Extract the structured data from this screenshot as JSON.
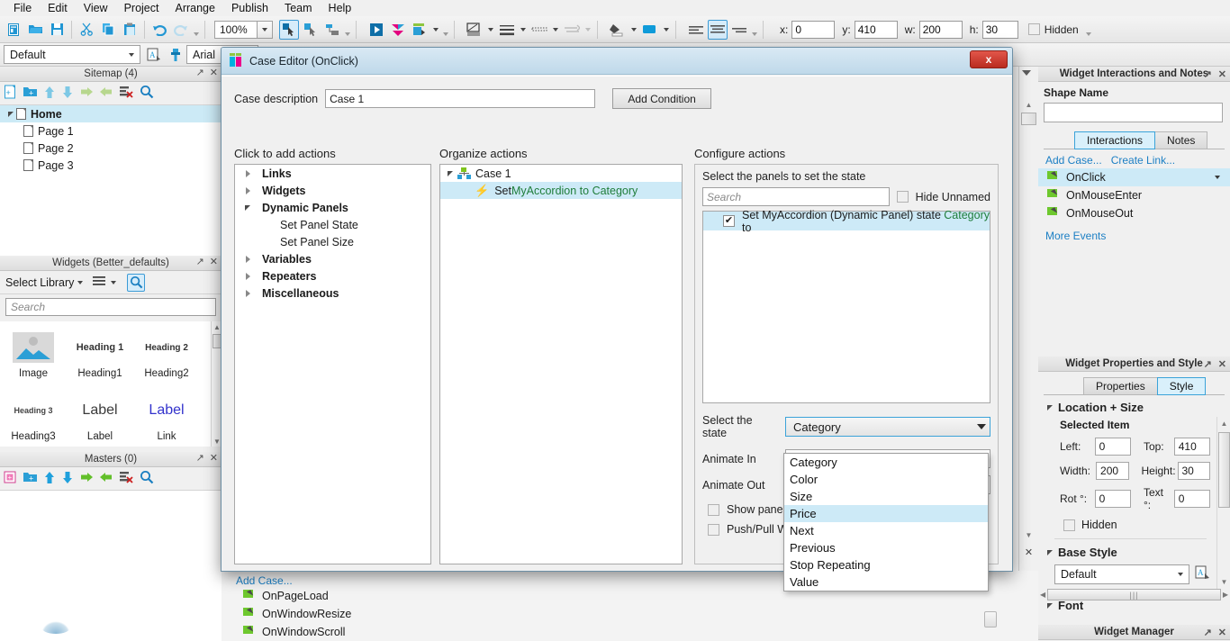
{
  "app": {
    "menu": [
      "File",
      "Edit",
      "View",
      "Project",
      "Arrange",
      "Publish",
      "Team",
      "Help"
    ]
  },
  "toolbar": {
    "zoom_value": "100%",
    "x_label": "x:",
    "x_value": "0",
    "y_label": "y:",
    "y_value": "410",
    "w_label": "w:",
    "w_value": "200",
    "h_label": "h:",
    "h_value": "30",
    "hidden_label": "Hidden"
  },
  "stylebar": {
    "style_value": "Default",
    "font_value": "Arial"
  },
  "sitemap": {
    "title": "Sitemap (4)",
    "nodes": [
      {
        "label": "Home",
        "depth": 0,
        "selected": true,
        "expanded": true
      },
      {
        "label": "Page 1",
        "depth": 1,
        "selected": false
      },
      {
        "label": "Page 2",
        "depth": 1,
        "selected": false
      },
      {
        "label": "Page 3",
        "depth": 1,
        "selected": false
      }
    ]
  },
  "widgets_panel": {
    "title": "Widgets (Better_defaults)",
    "select_library_label": "Select Library",
    "search_placeholder": "Search",
    "items": [
      {
        "label": "Image",
        "preview": "image-thumb"
      },
      {
        "label": "Heading1",
        "preview": "Heading 1"
      },
      {
        "label": "Heading2",
        "preview": "Heading 2"
      },
      {
        "label": "Heading3",
        "preview": "Heading 3"
      },
      {
        "label": "Label",
        "preview": "Label"
      },
      {
        "label": "Link",
        "preview": "Label"
      }
    ]
  },
  "masters_panel": {
    "title": "Masters (0)"
  },
  "dialog": {
    "title": "Case Editor (OnClick)",
    "close_label": "x",
    "case_description_label": "Case description",
    "case_description_value": "Case 1",
    "add_condition_label": "Add Condition",
    "col1_title": "Click to add actions",
    "col2_title": "Organize actions",
    "col3_title": "Configure actions",
    "actions_tree": [
      {
        "label": "Links",
        "depth": 0,
        "bold": true,
        "expandable": true,
        "expanded": false
      },
      {
        "label": "Widgets",
        "depth": 0,
        "bold": true,
        "expandable": true,
        "expanded": false
      },
      {
        "label": "Dynamic Panels",
        "depth": 0,
        "bold": true,
        "expandable": true,
        "expanded": true
      },
      {
        "label": "Set Panel State",
        "depth": 1,
        "bold": false,
        "expandable": false
      },
      {
        "label": "Set Panel Size",
        "depth": 1,
        "bold": false,
        "expandable": false
      },
      {
        "label": "Variables",
        "depth": 0,
        "bold": true,
        "expandable": true,
        "expanded": false
      },
      {
        "label": "Repeaters",
        "depth": 0,
        "bold": true,
        "expandable": true,
        "expanded": false
      },
      {
        "label": "Miscellaneous",
        "depth": 0,
        "bold": true,
        "expandable": true,
        "expanded": false
      }
    ],
    "organize": {
      "case_label": "Case 1",
      "action_prefix": "Set ",
      "action_target": "MyAccordion to Category"
    },
    "configure": {
      "panels_label": "Select the panels to set the state",
      "search_placeholder": "Search",
      "hide_unnamed_label": "Hide Unnamed",
      "panel_row_prefix": "Set MyAccordion (Dynamic Panel) state to ",
      "panel_row_state": "Category",
      "select_state_label": "Select the state",
      "select_state_value": "Category",
      "state_options": [
        "Category",
        "Color",
        "Size",
        "Price",
        "Next",
        "Previous",
        "Stop Repeating",
        "Value"
      ],
      "state_highlighted": "Price",
      "animate_in_label": "Animate In",
      "animate_out_label": "Animate Out",
      "show_panel_label": "Show panel",
      "push_pull_label": "Push/Pull W"
    }
  },
  "interactions_panel": {
    "title": "Widget Interactions and Notes",
    "shape_name_label": "Shape Name",
    "shape_name_value": "",
    "tabs": [
      {
        "label": "Interactions",
        "active": true
      },
      {
        "label": "Notes",
        "active": false
      }
    ],
    "add_case_label": "Add Case...",
    "create_link_label": "Create Link...",
    "events": [
      {
        "label": "OnClick",
        "selected": true,
        "has_caret": true
      },
      {
        "label": "OnMouseEnter",
        "selected": false,
        "has_caret": false
      },
      {
        "label": "OnMouseOut",
        "selected": false,
        "has_caret": false
      }
    ],
    "more_events_label": "More Events"
  },
  "properties_panel": {
    "title": "Widget Properties and Style",
    "tabs": [
      {
        "label": "Properties",
        "active": false
      },
      {
        "label": "Style",
        "active": true
      }
    ],
    "location_size_label": "Location + Size",
    "selected_item_label": "Selected Item",
    "fields": [
      {
        "label": "Left:",
        "value": "0"
      },
      {
        "label": "Top:",
        "value": "410"
      },
      {
        "label": "Width:",
        "value": "200"
      },
      {
        "label": "Height:",
        "value": "30"
      },
      {
        "label": "Rot °:",
        "value": "0"
      },
      {
        "label": "Text °:",
        "value": "0"
      }
    ],
    "hidden_label": "Hidden",
    "base_style_label": "Base Style",
    "base_style_value": "Default",
    "font_label": "Font"
  },
  "widget_manager": {
    "title": "Widget Manager"
  },
  "page_events": {
    "add_case_label": "Add Case...",
    "events": [
      "OnPageLoad",
      "OnWindowResize",
      "OnWindowScroll"
    ]
  },
  "colors": {
    "accent": "#3ba3d9",
    "selection": "#cdeaf7",
    "green": "#1f7d3a",
    "link": "#1c7fc4"
  }
}
